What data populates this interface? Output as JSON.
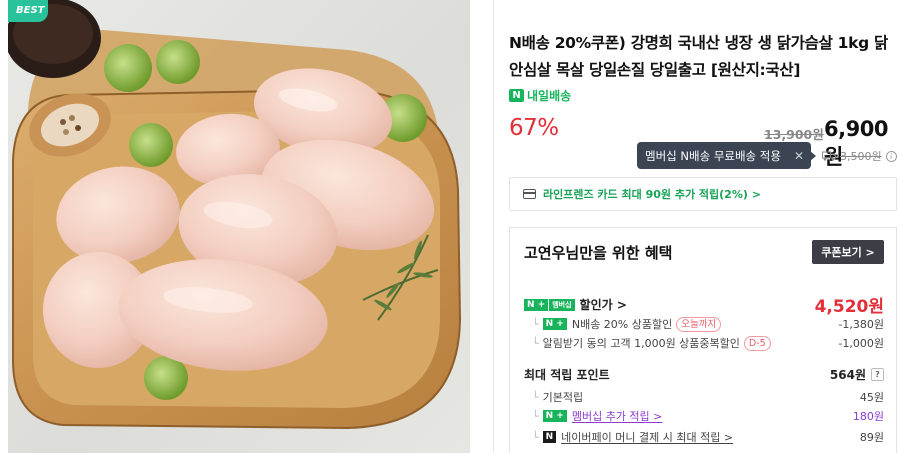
{
  "badge": "BEST",
  "product": {
    "title": "N배송 20%쿠폰) 강명희 국내산 냉장 생 닭가슴살 1kg 닭안심살 목살 당일손질 당일출고 [원산지:국산]",
    "delivery_label": "내일배송",
    "delivery_icon": "N"
  },
  "price": {
    "discount_rate": "67%",
    "original": "13,900원",
    "sale": "6,900원"
  },
  "shipping": {
    "tooltip": "멤버십 N배송 무료배송 적용",
    "fee": "3,500원",
    "icon": "truck-icon"
  },
  "card_promo": {
    "text": "라인프렌즈 카드 최대 90원 추가 적립(2%) >"
  },
  "benefit": {
    "heading": "고연우님만을 위한 혜택",
    "coupon_button": "쿠폰보기 >",
    "member_price_label": "할인가 >",
    "member_price": "4,520원",
    "membership_tag": "멤버십",
    "discounts": [
      {
        "label": "N배송 20% 상품할인",
        "tag": "오늘까지",
        "value": "-1,380원"
      },
      {
        "label": "알림받기 동의 고객 1,000원 상품중복할인",
        "tag": "D-5",
        "value": "-1,000원"
      }
    ],
    "points_label": "최대 적립 포인트",
    "points_total": "564원",
    "points_help": "?",
    "points": [
      {
        "label": "기본적립",
        "value": "45원"
      },
      {
        "label": "멤버십 추가 적립 >",
        "value": "180원"
      },
      {
        "label": "네이버페이 머니 결제 시 최대 적립 >",
        "value": "89원"
      }
    ]
  }
}
